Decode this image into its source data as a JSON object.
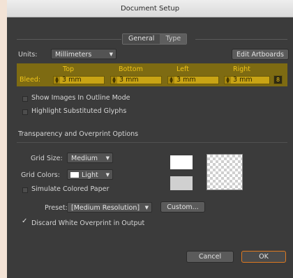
{
  "window": {
    "title": "Document Setup"
  },
  "tabs": [
    {
      "label": "General"
    },
    {
      "label": "Type"
    }
  ],
  "units": {
    "label": "Units:",
    "value": "Millimeters"
  },
  "edit_artboards_label": "Edit Artboards",
  "bleed": {
    "label": "Bleed:",
    "headers": {
      "top": "Top",
      "bottom": "Bottom",
      "left": "Left",
      "right": "Right"
    },
    "values": {
      "top": "3 mm",
      "bottom": "3 mm",
      "left": "3 mm",
      "right": "3 mm"
    }
  },
  "checkboxes": {
    "outline_mode": "Show Images In Outline Mode",
    "highlight_glyphs": "Highlight Substituted Glyphs"
  },
  "transparency": {
    "section_title": "Transparency and Overprint Options",
    "grid_size_label": "Grid Size:",
    "grid_size_value": "Medium",
    "grid_colors_label": "Grid Colors:",
    "grid_colors_value": "Light",
    "simulate_paper": "Simulate Colored Paper",
    "preset_label": "Preset:",
    "preset_value": "[Medium Resolution]",
    "custom_label": "Custom...",
    "discard_white": "Discard White Overprint in Output"
  },
  "footer": {
    "cancel": "Cancel",
    "ok": "OK"
  },
  "colors": {
    "bleed_highlight": "#7e6b12",
    "bleed_text": "#f0c419",
    "dialog_bg": "#3b3b3b",
    "ok_border": "#e07a20"
  },
  "icons": {
    "stepper": "stepper-icon",
    "link": "link-icon",
    "dropdown": "chevron-down-icon",
    "check": "checkmark-icon"
  }
}
